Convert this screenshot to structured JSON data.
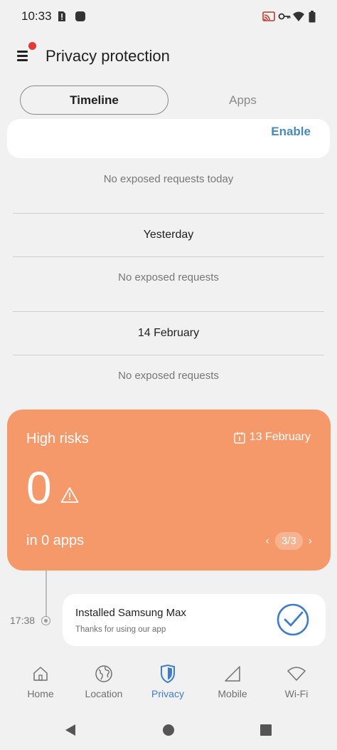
{
  "status_bar": {
    "time": "10:33",
    "left_icons": [
      "sim-alert-icon",
      "app-notification-icon"
    ],
    "right_icons": [
      "cast-icon",
      "vpn-key-icon",
      "wifi-icon",
      "battery-icon"
    ]
  },
  "app_bar": {
    "title": "Privacy protection",
    "menu_icon": "menu-icon",
    "has_notification_dot": true
  },
  "tabs": [
    {
      "label": "Timeline",
      "selected": true
    },
    {
      "label": "Apps",
      "selected": false
    }
  ],
  "enable_card": {
    "button_label": "Enable"
  },
  "timeline": {
    "today_empty": "No exposed requests today",
    "sections": [
      {
        "heading": "Yesterday",
        "empty_text": "No exposed requests"
      },
      {
        "heading": "14 February",
        "empty_text": "No exposed requests"
      }
    ]
  },
  "risk_card": {
    "title": "High risks",
    "date": "13 February",
    "count": "0",
    "apps_text": "in 0 apps",
    "pager": "3/3",
    "background_color": "#f5996b"
  },
  "event": {
    "time": "17:38",
    "title": "Installed Samsung Max",
    "subtitle": "Thanks for using our app"
  },
  "bottom_nav": [
    {
      "label": "Home",
      "icon": "home-icon",
      "active": false
    },
    {
      "label": "Location",
      "icon": "globe-icon",
      "active": false
    },
    {
      "label": "Privacy",
      "icon": "shield-icon",
      "active": true
    },
    {
      "label": "Mobile",
      "icon": "signal-icon",
      "active": false
    },
    {
      "label": "Wi-Fi",
      "icon": "wifi-icon",
      "active": false
    }
  ],
  "colors": {
    "accent": "#3f7dc4",
    "enable_text": "#4a8ab8",
    "background": "#f1f1f1"
  }
}
